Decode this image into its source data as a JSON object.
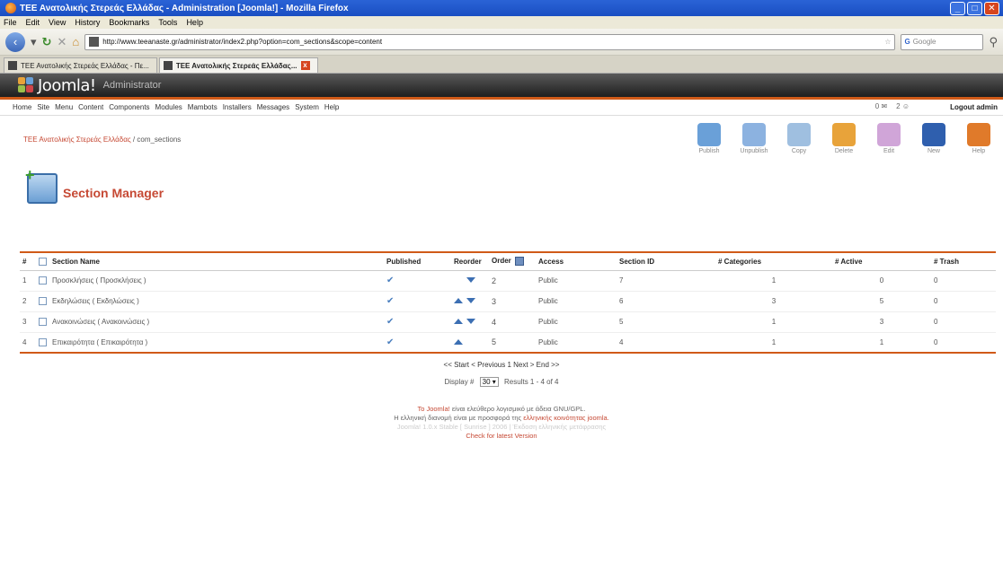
{
  "browser": {
    "title": "ΤΕΕ Ανατολικής Στερεάς Ελλάδας - Administration [Joomla!] - Mozilla Firefox",
    "menu": [
      "File",
      "Edit",
      "View",
      "History",
      "Bookmarks",
      "Tools",
      "Help"
    ],
    "url": "http://www.teeanaste.gr/administrator/index2.php?option=com_sections&scope=content",
    "search_placeholder": "Google",
    "tabs": [
      {
        "label": "ΤΕΕ Ανατολικής Στερεάς Ελλάδας - Πε..."
      },
      {
        "label": "ΤΕΕ Ανατολικής Στερεάς Ελλάδας..."
      }
    ],
    "win_buttons": [
      "_",
      "□",
      "✕"
    ]
  },
  "joomla": {
    "logo": "Joomla!",
    "subtitle": "Administrator",
    "menu": [
      "Home",
      "Site",
      "Menu",
      "Content",
      "Components",
      "Modules",
      "Mambots",
      "Installers",
      "Messages",
      "System",
      "Help"
    ],
    "stat_messages": "0",
    "stat_users": "2",
    "logout": "Logout admin",
    "breadcrumb_site": "ΤΕΕ Ανατολικής Στερεάς Ελλάδας",
    "breadcrumb_page": "/ com_sections",
    "toolbar": [
      "Publish",
      "Unpublish",
      "Copy",
      "Delete",
      "Edit",
      "New",
      "Help"
    ],
    "toolbar_colors": [
      "#6aa0d8",
      "#8cb2e0",
      "#9fbfe0",
      "#e8a33a",
      "#d0a5d8",
      "#2f5fae",
      "#e07a2a"
    ],
    "page_title": "Section Manager"
  },
  "table": {
    "headers": [
      "#",
      "Section Name",
      "Published",
      "Reorder",
      "Order",
      "Access",
      "Section ID",
      "# Categories",
      "# Active",
      "# Trash"
    ],
    "rows": [
      {
        "num": "1",
        "name": "Προσκλήσεις ( Προσκλήσεις )",
        "up": false,
        "down": true,
        "order": "2",
        "access": "Public",
        "id": "7",
        "categories": "1",
        "active": "0",
        "trash": "0"
      },
      {
        "num": "2",
        "name": "Εκδηλώσεις ( Εκδηλώσεις )",
        "up": true,
        "down": true,
        "order": "3",
        "access": "Public",
        "id": "6",
        "categories": "3",
        "active": "5",
        "trash": "0"
      },
      {
        "num": "3",
        "name": "Ανακοινώσεις ( Ανακοινώσεις )",
        "up": true,
        "down": true,
        "order": "4",
        "access": "Public",
        "id": "5",
        "categories": "1",
        "active": "3",
        "trash": "0"
      },
      {
        "num": "4",
        "name": "Επικαιρότητα ( Επικαιρότητα )",
        "up": true,
        "down": false,
        "order": "5",
        "access": "Public",
        "id": "4",
        "categories": "1",
        "active": "1",
        "trash": "0"
      }
    ]
  },
  "pager": {
    "nav": "<< Start < Previous 1 Next > End >>",
    "display_label": "Display #",
    "display_value": "30",
    "results": "Results 1 - 4 of 4"
  },
  "footer": {
    "line1_link": "Το Joomla!",
    "line1": "είναι ελεύθερο λογισμικό με άδεια GNU/GPL.",
    "line2": "Η ελληνική διανομή είναι με προσφορά της",
    "line2_link": "ελληνικής κοινότητας joomla.",
    "line3": "Joomla! 1.0.x Stable [ Sunrise ] 2006 | Έκδοση ελληνικής μετάφρασης",
    "check": "Check for latest Version"
  }
}
